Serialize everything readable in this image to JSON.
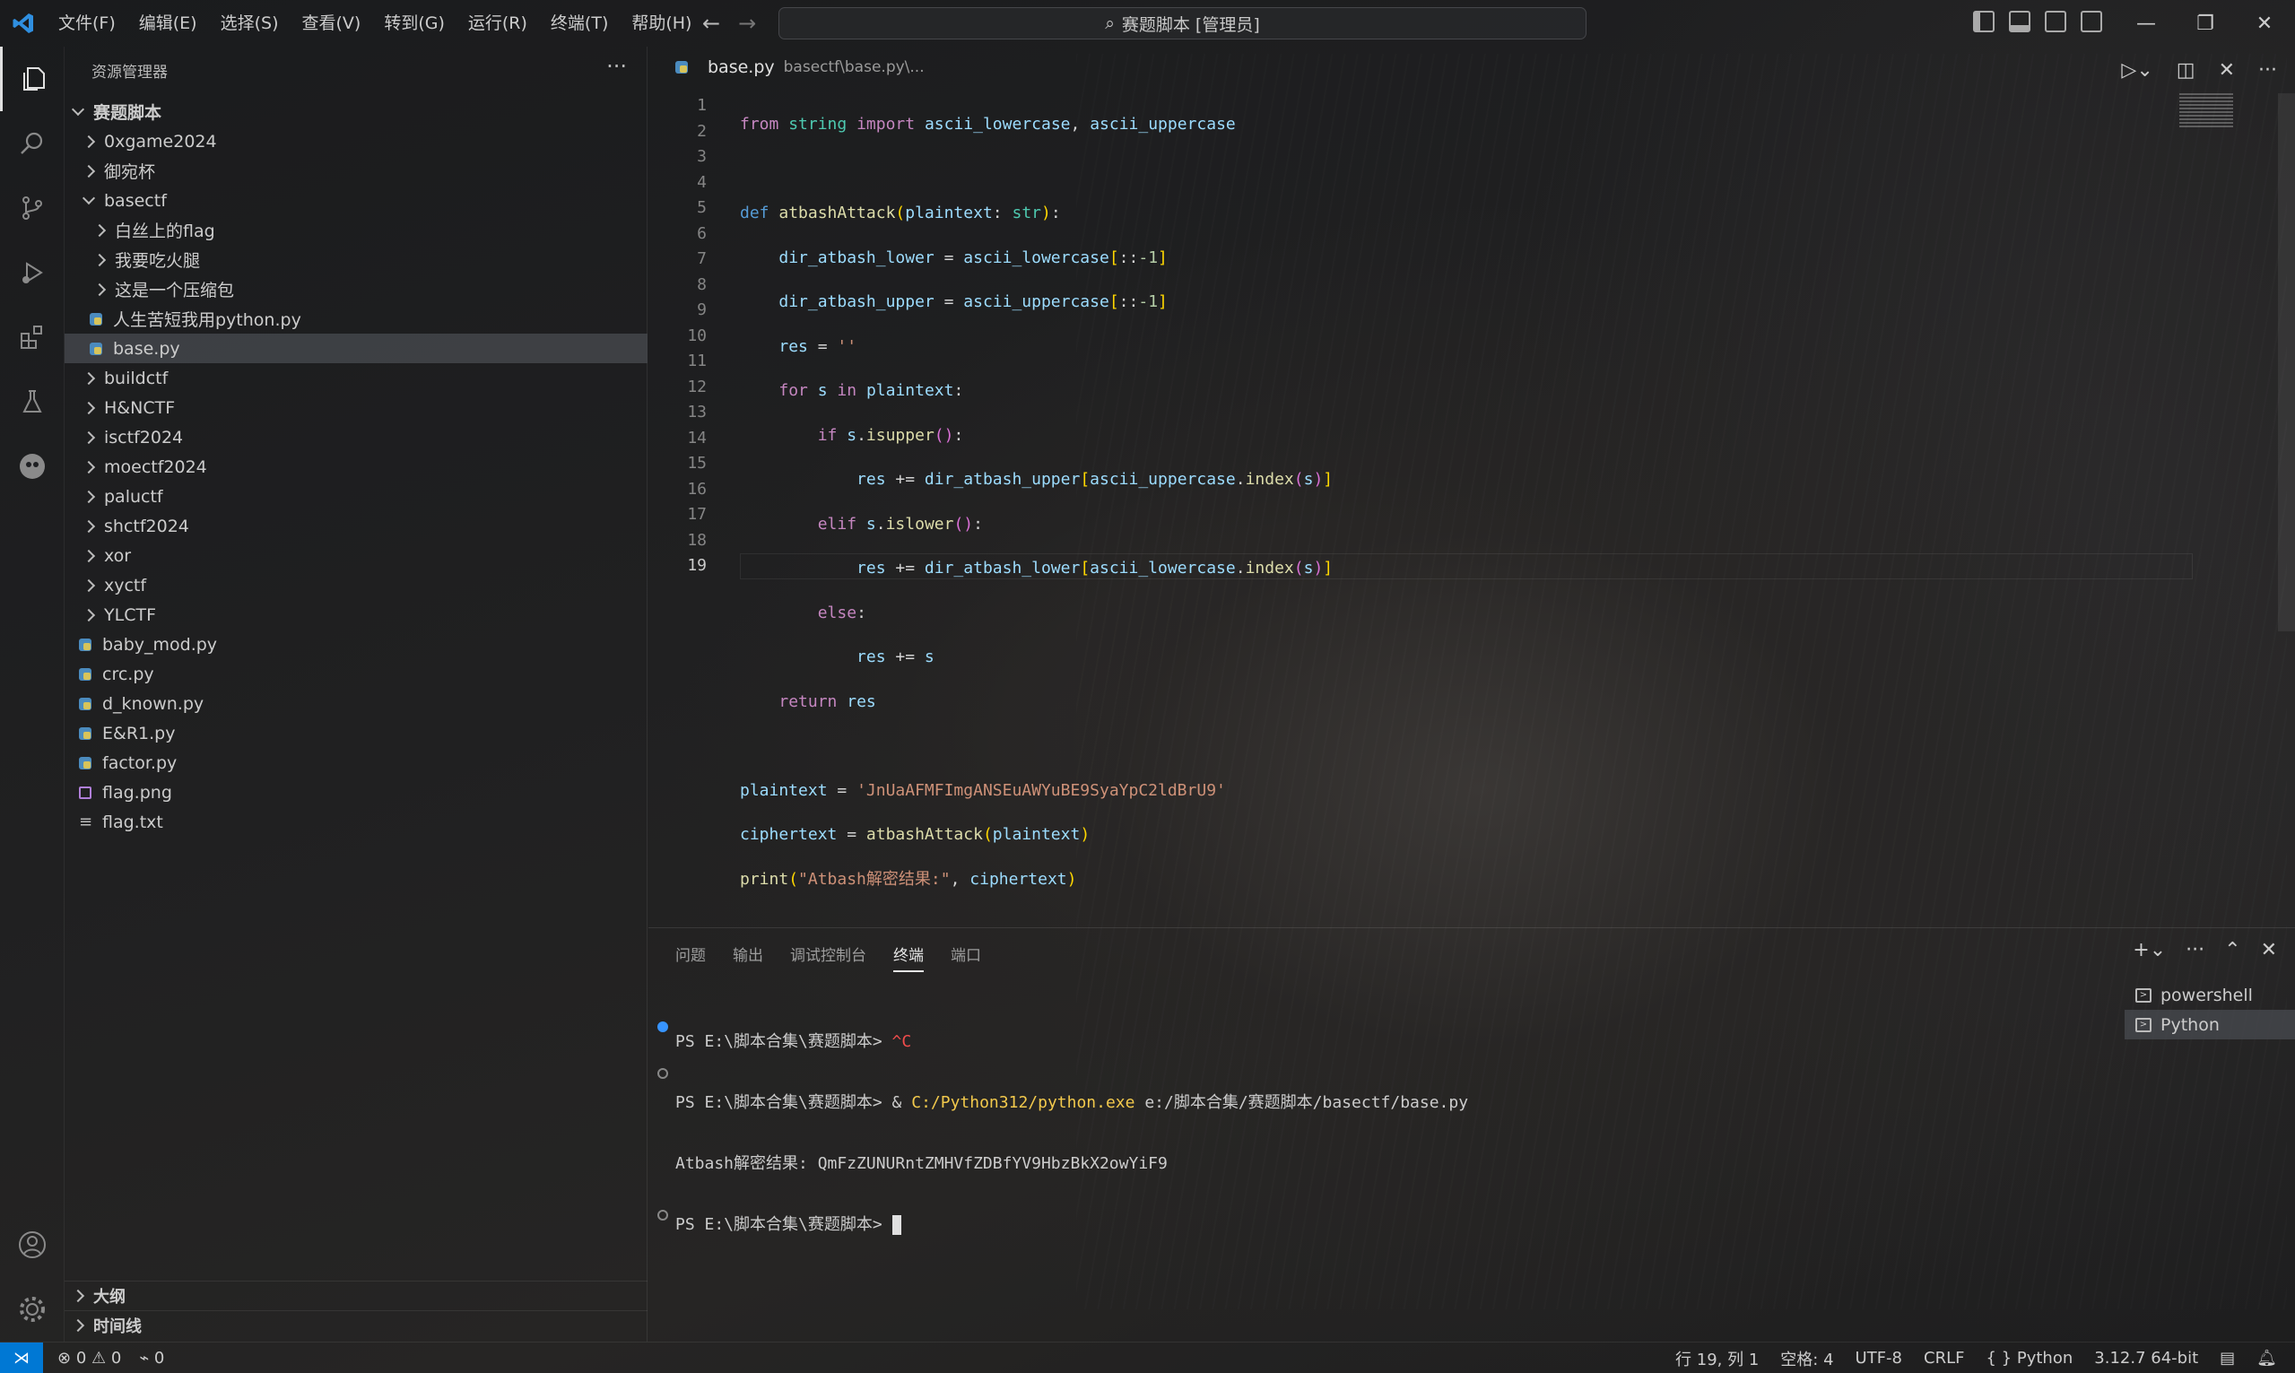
{
  "window": {
    "search_label": "赛题脚本 [管理员]"
  },
  "menu": [
    "文件(F)",
    "编辑(E)",
    "选择(S)",
    "查看(V)",
    "转到(G)",
    "运行(R)",
    "终端(T)",
    "帮助(H)"
  ],
  "sidebar": {
    "title": "资源管理器",
    "root": "赛题脚本",
    "items": [
      {
        "label": "0xgame2024",
        "kind": "folder",
        "open": false,
        "depth": 1
      },
      {
        "label": "御宛杯",
        "kind": "folder",
        "open": false,
        "depth": 1
      },
      {
        "label": "basectf",
        "kind": "folder",
        "open": true,
        "depth": 1
      },
      {
        "label": "白丝上的flag",
        "kind": "folder",
        "open": false,
        "depth": 2
      },
      {
        "label": "我要吃火腿",
        "kind": "folder",
        "open": false,
        "depth": 2
      },
      {
        "label": "这是一个压缩包",
        "kind": "folder",
        "open": false,
        "depth": 2
      },
      {
        "label": "人生苦短我用python.py",
        "kind": "py",
        "depth": 2
      },
      {
        "label": "base.py",
        "kind": "py",
        "depth": 2,
        "selected": true
      },
      {
        "label": "buildctf",
        "kind": "folder",
        "open": false,
        "depth": 1
      },
      {
        "label": "H&NCTF",
        "kind": "folder",
        "open": false,
        "depth": 1
      },
      {
        "label": "isctf2024",
        "kind": "folder",
        "open": false,
        "depth": 1
      },
      {
        "label": "moectf2024",
        "kind": "folder",
        "open": false,
        "depth": 1
      },
      {
        "label": "paluctf",
        "kind": "folder",
        "open": false,
        "depth": 1
      },
      {
        "label": "shctf2024",
        "kind": "folder",
        "open": false,
        "depth": 1
      },
      {
        "label": "xor",
        "kind": "folder",
        "open": false,
        "depth": 1
      },
      {
        "label": "xyctf",
        "kind": "folder",
        "open": false,
        "depth": 1
      },
      {
        "label": "YLCTF",
        "kind": "folder",
        "open": false,
        "depth": 1
      },
      {
        "label": "baby_mod.py",
        "kind": "py",
        "depth": 1
      },
      {
        "label": "crc.py",
        "kind": "py",
        "depth": 1
      },
      {
        "label": "d_known.py",
        "kind": "py",
        "depth": 1
      },
      {
        "label": "E&R1.py",
        "kind": "py",
        "depth": 1
      },
      {
        "label": "factor.py",
        "kind": "py",
        "depth": 1
      },
      {
        "label": "flag.png",
        "kind": "img",
        "depth": 1
      },
      {
        "label": "flag.txt",
        "kind": "txt",
        "depth": 1
      }
    ],
    "outline_label": "大纲",
    "timeline_label": "时间线"
  },
  "editor": {
    "tab_label": "base.py",
    "tab_path": "basectf\\base.py\\...",
    "line_numbers": [
      "1",
      "2",
      "3",
      "4",
      "5",
      "6",
      "7",
      "8",
      "9",
      "10",
      "11",
      "12",
      "13",
      "14",
      "15",
      "16",
      "17",
      "18",
      "19"
    ],
    "current_line": "19"
  },
  "panel": {
    "tabs": [
      "问题",
      "输出",
      "调试控制台",
      "终端",
      "端口"
    ],
    "active_tab": "终端",
    "terminal_lines": [
      {
        "prompt": "PS E:\\脚本合集\\赛题脚本> ",
        "cmd": "^C"
      },
      {
        "prompt": "PS E:\\脚本合集\\赛题脚本> ",
        "amp": "& ",
        "exe": "C:/Python312/python.exe",
        "args": " e:/脚本合集/赛题脚本/basectf/base.py"
      },
      {
        "output": "Atbash解密结果: QmFzZUNURntZMHVfZDBfYV9HbzBkX2owYiF9"
      },
      {
        "prompt": "PS E:\\脚本合集\\赛题脚本> "
      }
    ],
    "terminals": [
      "powershell",
      "Python"
    ]
  },
  "status": {
    "errors": "0",
    "warnings": "0",
    "ports": "0",
    "position": "行 19, 列 1",
    "spaces": "空格: 4",
    "encoding": "UTF-8",
    "eol": "CRLF",
    "language": "Python",
    "interpreter": "3.12.7 64-bit"
  },
  "colors": {
    "accent": "#0078d4",
    "keyword": "#c586c0",
    "string": "#ce9178",
    "function": "#dcdcaa",
    "variable": "#9cdcfe"
  }
}
